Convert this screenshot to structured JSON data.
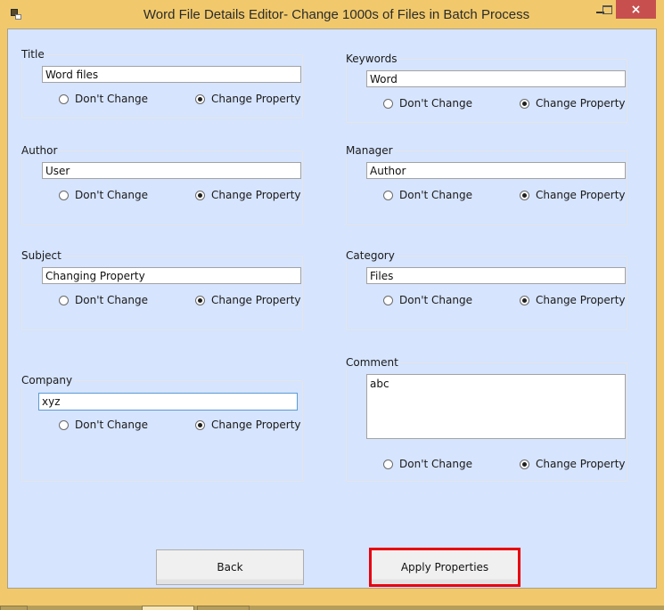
{
  "window": {
    "title": "Word File Details Editor- Change 1000s of Files in Batch Process",
    "icon": "app-icon",
    "controls": {
      "minimize": "minimize-icon",
      "maximize": "maximize-icon",
      "close": "×"
    }
  },
  "radio_labels": {
    "dont_change": "Don't Change",
    "change_property": "Change Property"
  },
  "fields": {
    "title": {
      "label": "Title",
      "value": "Word files",
      "selected": "change_property"
    },
    "author": {
      "label": "Author",
      "value": "User",
      "selected": "change_property"
    },
    "subject": {
      "label": "Subject",
      "value": "Changing Property",
      "selected": "change_property"
    },
    "company": {
      "label": "Company",
      "value": "xyz",
      "selected": "change_property"
    },
    "keywords": {
      "label": "Keywords",
      "value": "Word",
      "selected": "change_property"
    },
    "manager": {
      "label": "Manager",
      "value": "Author",
      "selected": "change_property"
    },
    "category": {
      "label": "Category",
      "value": "Files",
      "selected": "change_property"
    },
    "comment": {
      "label": "Comment",
      "value": "abc",
      "selected": "change_property"
    }
  },
  "buttons": {
    "back": "Back",
    "apply": "Apply Properties"
  },
  "colors": {
    "client_bg": "#d6e4fd",
    "frame": "#f1c96c",
    "close": "#c7504e",
    "highlight": "#e8000f"
  }
}
